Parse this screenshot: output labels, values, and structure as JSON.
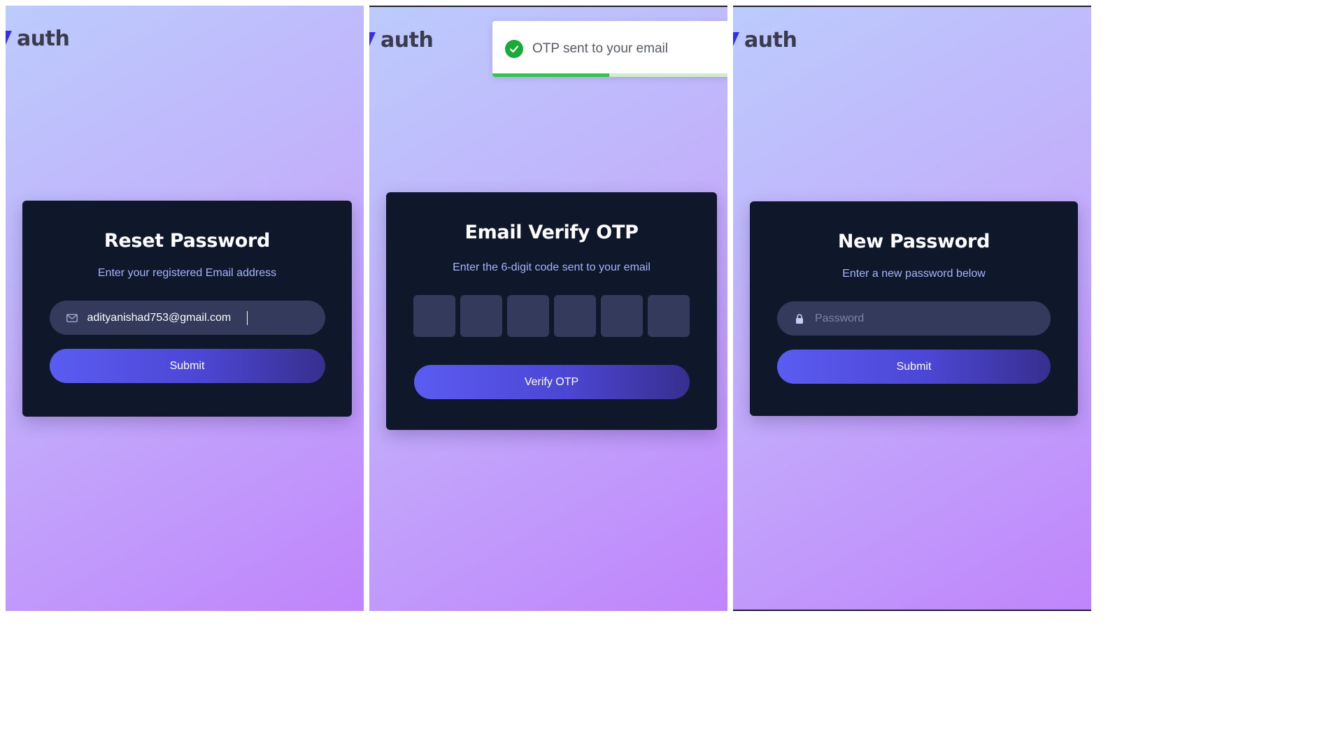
{
  "colors": {
    "card_bg": "#0f172a",
    "accent": "#5a5cf1",
    "subtitle": "#a5b4fc",
    "field_bg": "#333a5c",
    "success": "#1aaa3a"
  },
  "logo": {
    "text": "auth"
  },
  "reset_password": {
    "title": "Reset Password",
    "subtitle": "Enter your registered Email address",
    "email_value": "adityanishad753@gmail.com",
    "email_icon": "mail-icon",
    "submit_label": "Submit"
  },
  "verify_otp": {
    "title": "Email Verify OTP",
    "subtitle": "Enter the 6-digit code sent to your email",
    "digits": [
      "",
      "",
      "",
      "",
      "",
      ""
    ],
    "button_label": "Verify OTP",
    "toast": {
      "message": "OTP sent to your email",
      "icon": "check-circle-icon",
      "progress": 0.49
    }
  },
  "new_password": {
    "title": "New Password",
    "subtitle": "Enter a new password below",
    "password_placeholder": "Password",
    "password_icon": "lock-icon",
    "submit_label": "Submit"
  }
}
